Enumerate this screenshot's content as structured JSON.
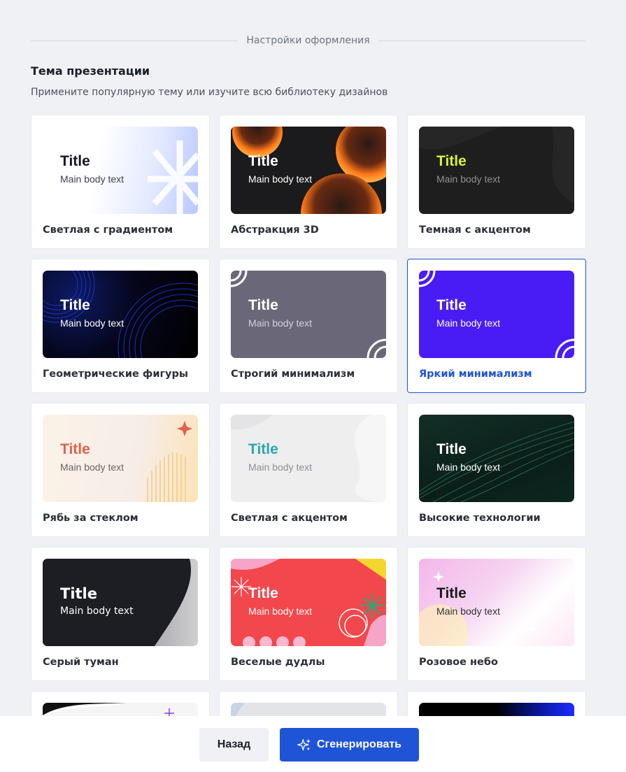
{
  "section": {
    "divider_label": "Настройки оформления"
  },
  "theme": {
    "heading": "Тема презентации",
    "subtitle": "Примените популярную тему или изучите всю библиотеку дизайнов"
  },
  "preview": {
    "title": "Title",
    "body": "Main body text"
  },
  "cards": [
    {
      "name": "Светлая с градиентом",
      "selected": false
    },
    {
      "name": "Абстракция 3D",
      "selected": false
    },
    {
      "name": "Темная с акцентом",
      "selected": false
    },
    {
      "name": "Геометрические фигуры",
      "selected": false
    },
    {
      "name": "Строгий минимализм",
      "selected": false
    },
    {
      "name": "Яркий минимализм",
      "selected": true
    },
    {
      "name": "Рябь за стеклом",
      "selected": false
    },
    {
      "name": "Светлая с акцентом",
      "selected": false
    },
    {
      "name": "Высокие технологии",
      "selected": false
    },
    {
      "name": "Серый туман",
      "selected": false
    },
    {
      "name": "Веселые дудлы",
      "selected": false
    },
    {
      "name": "Розовое небо",
      "selected": false
    }
  ],
  "footer": {
    "back_label": "Назад",
    "generate_label": "Сгенерировать"
  },
  "colors": {
    "accent": "#1f54d6",
    "background": "#eff1f5"
  }
}
